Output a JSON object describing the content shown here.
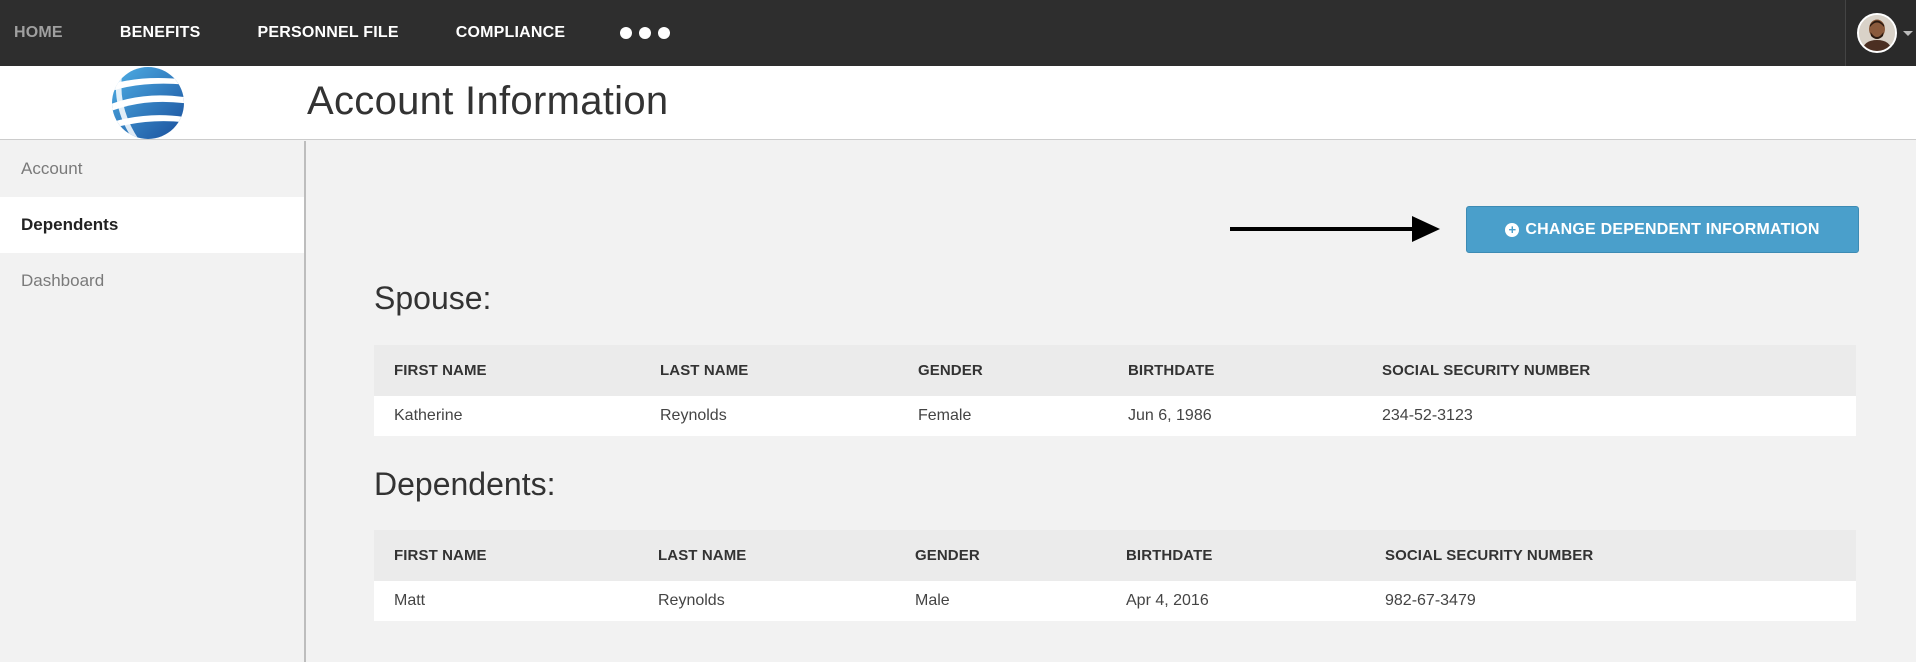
{
  "nav": {
    "items": [
      {
        "label": "HOME"
      },
      {
        "label": "BENEFITS"
      },
      {
        "label": "PERSONNEL FILE"
      },
      {
        "label": "COMPLIANCE"
      }
    ]
  },
  "header": {
    "title": "Account Information"
  },
  "sidebar": {
    "items": [
      {
        "label": "Account"
      },
      {
        "label": "Dependents"
      },
      {
        "label": "Dashboard"
      }
    ]
  },
  "main": {
    "change_button_label": "CHANGE DEPENDENT INFORMATION",
    "spouse": {
      "title": "Spouse:",
      "columns": [
        "FIRST NAME",
        "LAST NAME",
        "GENDER",
        "BIRTHDATE",
        "SOCIAL SECURITY NUMBER"
      ],
      "rows": [
        [
          "Katherine",
          "Reynolds",
          "Female",
          "Jun 6, 1986",
          "234-52-3123"
        ]
      ]
    },
    "dependents": {
      "title": "Dependents:",
      "columns": [
        "FIRST NAME",
        "LAST NAME",
        "GENDER",
        "BIRTHDATE",
        "SOCIAL SECURITY NUMBER"
      ],
      "rows": [
        [
          "Matt",
          "Reynolds",
          "Male",
          "Apr 4, 2016",
          "982-67-3479"
        ]
      ]
    }
  },
  "colors": {
    "topbar": "#2e2e2e",
    "accent_button": "#4a9fcb",
    "nav_muted": "#a0a0a0"
  },
  "icons": {
    "logo": "globe-logo-icon",
    "more": "more-dots-icon",
    "avatar": "avatar",
    "button": "plus-circle-icon",
    "arrow": "arrow-right-icon"
  }
}
